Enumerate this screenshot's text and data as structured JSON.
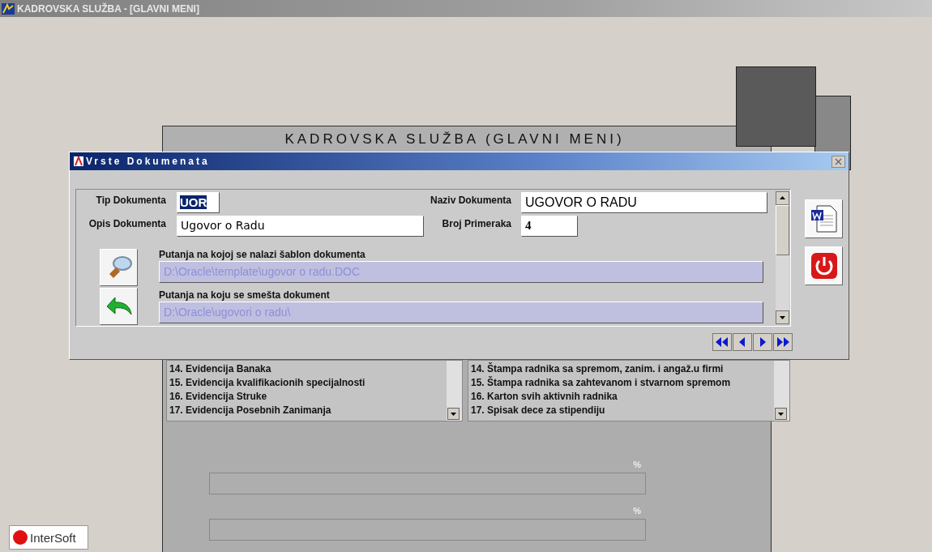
{
  "window": {
    "title": "KADROVSKA SLUŽBA - [GLAVNI MENI]"
  },
  "main": {
    "heading": "KADROVSKA SLUŽBA (GLAVNI MENI)",
    "lists": [
      {
        "items": [
          "14. Evidencija Banaka",
          "15. Evidencija kvalifikacionih specijalnosti",
          "16. Evidencija Struke",
          "17. Evidencija Posebnih Zanimanja"
        ]
      },
      {
        "items": [
          "14. Štampa radnika sa spremom, zanim. i angaž.u firmi",
          "15. Štampa radnika sa zahtevanom i stvarnom spremom",
          "16. Karton svih aktivnih radnika",
          "17. Spisak dece za stipendiju"
        ]
      }
    ],
    "progress": [
      {
        "label": "%",
        "level": 0
      },
      {
        "label": "%",
        "level": 0
      }
    ]
  },
  "dialog": {
    "title": "Vrste Dokumenata",
    "tip": {
      "label": "Tip Dokumenta",
      "value": "UOR"
    },
    "naziv": {
      "label": "Naziv Dokumenta",
      "value": "UGOVOR O RADU"
    },
    "opis": {
      "label": "Opis Dokumenta",
      "value": "Ugovor o Radu"
    },
    "broj": {
      "label": "Broj Primeraka",
      "value": "4"
    },
    "paths": [
      {
        "label": "Putanja na kojoj se nalazi šablon dokumenta",
        "value": "D:\\Oracle\\template\\ugovor o radu.DOC"
      },
      {
        "label": "Putanja na koju se smešta dokument",
        "value": "D:\\Oracle\\ugovori o radu\\"
      }
    ]
  },
  "logo": {
    "text": "InterSoft"
  }
}
